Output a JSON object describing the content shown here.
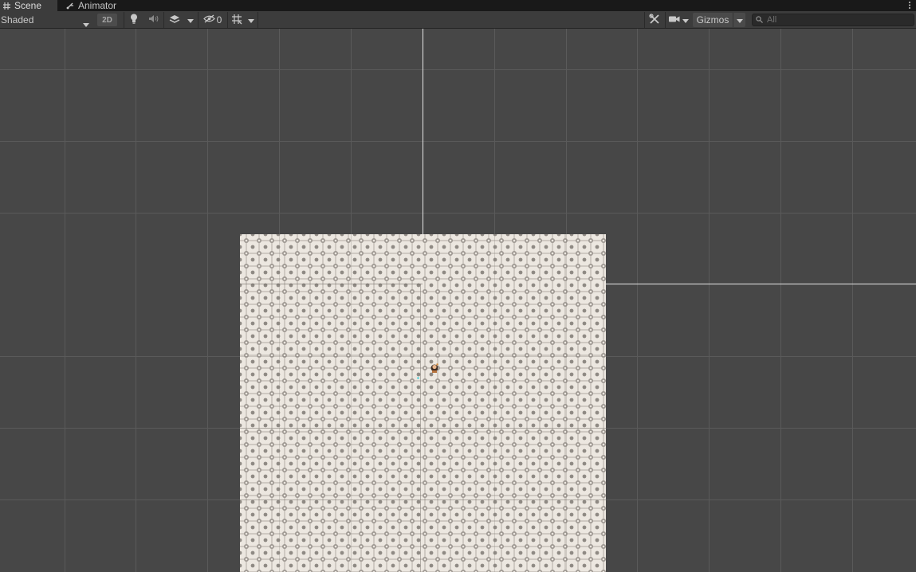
{
  "tabs": [
    {
      "label": "Scene",
      "icon": "grid-hash-icon",
      "active": true
    },
    {
      "label": "Animator",
      "icon": "animator-graph-icon",
      "active": false
    }
  ],
  "toolbar": {
    "draw_mode": "Shaded",
    "toggle_2d": "2D",
    "lighting_icon": "lightbulb-icon",
    "audio_icon": "speaker-icon",
    "effects_icon": "layers-icon",
    "hidden_objects_icon": "eye-slash-icon",
    "hidden_objects_count": "0",
    "grid_icon": "grid-snap-icon",
    "tools_icon": "wrench-icon",
    "camera_icon": "camera-icon",
    "gizmos_label": "Gizmos",
    "search_placeholder": "All"
  },
  "colors": {
    "viewport_bg": "#474747",
    "grid_line": "#5a5a5a",
    "axis_line": "#e6e6e6",
    "toolbar_bg": "#3c3c3c",
    "tabbar_bg": "#191919",
    "tile_light": "#ece7e0",
    "tile_dark": "#8f8a84"
  },
  "scene": {
    "sprite_name": "tiled-floor",
    "character_icon": "character-sprite-icon"
  }
}
